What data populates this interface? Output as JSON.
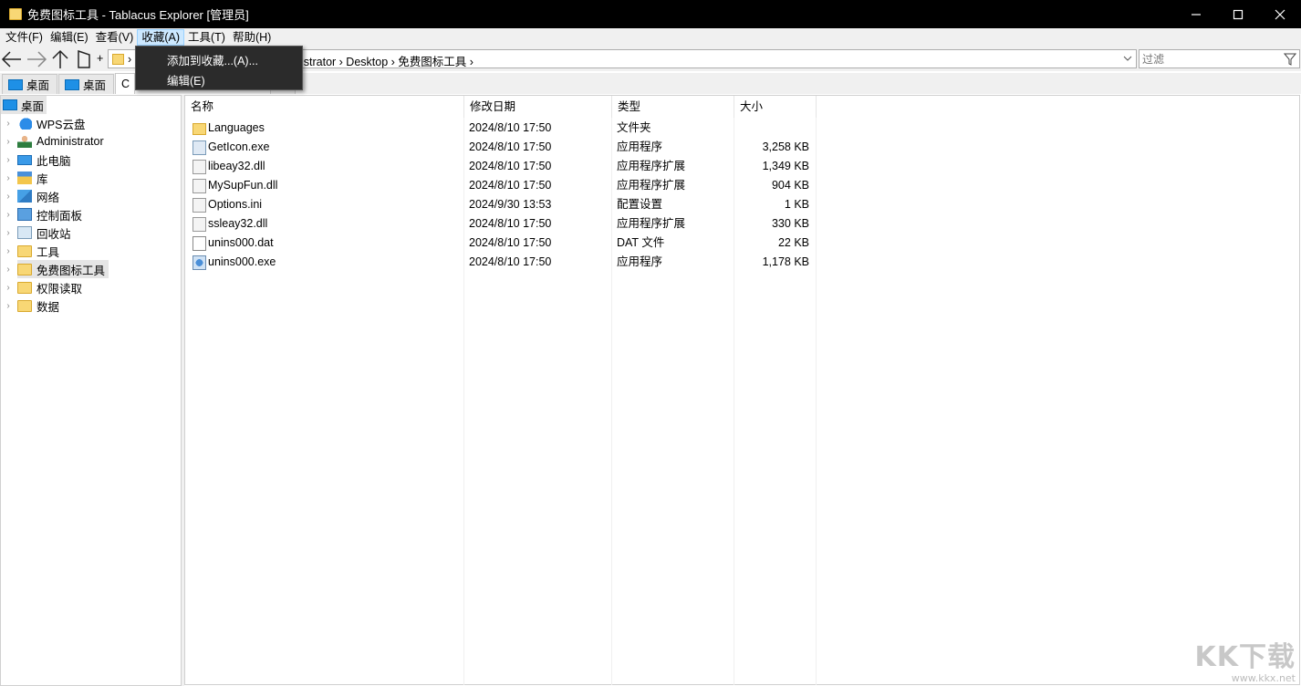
{
  "window": {
    "title": "免费图标工具 - Tablacus Explorer [管理员]"
  },
  "menubar": {
    "items": [
      "文件(F)",
      "编辑(E)",
      "查看(V)",
      "收藏(A)",
      "工具(T)",
      "帮助(H)"
    ]
  },
  "favorites_menu": {
    "items": [
      "添加到收藏...(A)...",
      "编辑(E)"
    ]
  },
  "toolbar": {
    "plus_label": "+",
    "path_chevron": "›",
    "address_path": "istrator › Desktop › 免费图标工具 ›",
    "filter_placeholder": "过滤"
  },
  "tabs": {
    "items": [
      "桌面",
      "桌面",
      "C"
    ]
  },
  "tree": {
    "root": "桌面",
    "items": [
      {
        "label": "WPS云盘",
        "icon": "cloud-icon"
      },
      {
        "label": "Administrator",
        "icon": "user-icon"
      },
      {
        "label": "此电脑",
        "icon": "computer-icon"
      },
      {
        "label": "库",
        "icon": "library-icon"
      },
      {
        "label": "网络",
        "icon": "network-icon"
      },
      {
        "label": "控制面板",
        "icon": "control-panel-icon"
      },
      {
        "label": "回收站",
        "icon": "recycle-bin-icon"
      },
      {
        "label": "工具",
        "icon": "folder-icon"
      },
      {
        "label": "免费图标工具",
        "icon": "folder-icon"
      },
      {
        "label": "权限读取",
        "icon": "folder-icon"
      },
      {
        "label": "数据",
        "icon": "folder-icon"
      }
    ]
  },
  "files": {
    "columns": [
      "名称",
      "修改日期",
      "类型",
      "大小"
    ],
    "rows": [
      {
        "name": "Languages",
        "date": "2024/8/10 17:50",
        "type": "文件夹",
        "size": "",
        "icon": "folder-icon"
      },
      {
        "name": "GetIcon.exe",
        "date": "2024/8/10 17:50",
        "type": "应用程序",
        "size": "3,258 KB",
        "icon": "exe-icon"
      },
      {
        "name": "libeay32.dll",
        "date": "2024/8/10 17:50",
        "type": "应用程序扩展",
        "size": "1,349 KB",
        "icon": "dll-icon"
      },
      {
        "name": "MySupFun.dll",
        "date": "2024/8/10 17:50",
        "type": "应用程序扩展",
        "size": "904 KB",
        "icon": "dll-icon"
      },
      {
        "name": "Options.ini",
        "date": "2024/9/30 13:53",
        "type": "配置设置",
        "size": "1 KB",
        "icon": "ini-icon"
      },
      {
        "name": "ssleay32.dll",
        "date": "2024/8/10 17:50",
        "type": "应用程序扩展",
        "size": "330 KB",
        "icon": "dll-icon"
      },
      {
        "name": "unins000.dat",
        "date": "2024/8/10 17:50",
        "type": "DAT 文件",
        "size": "22 KB",
        "icon": "dat-icon"
      },
      {
        "name": "unins000.exe",
        "date": "2024/8/10 17:50",
        "type": "应用程序",
        "size": "1,178 KB",
        "icon": "installer-icon"
      }
    ]
  },
  "watermark": {
    "big": "KK下载",
    "small": "www.kkx.net"
  }
}
